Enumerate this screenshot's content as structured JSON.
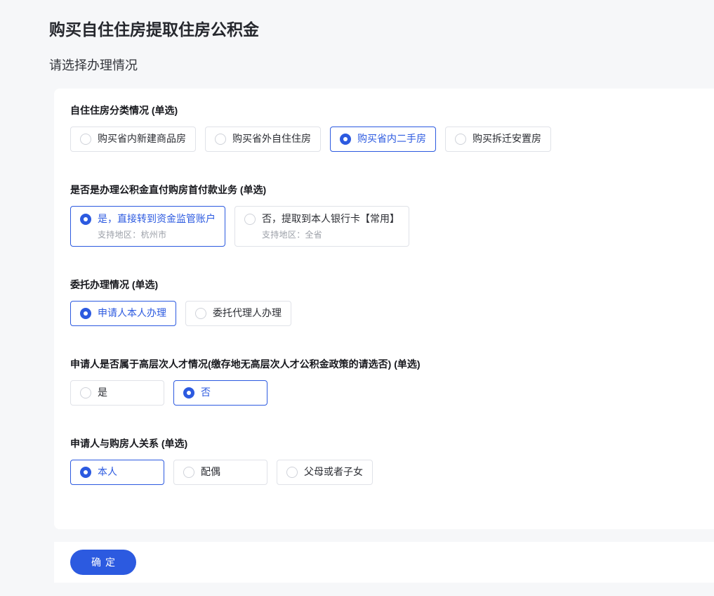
{
  "colors": {
    "accent": "#2c5ae0",
    "page_background": "#f6f7f9",
    "card_background": "#ffffff",
    "unselected_border": "#e0e2e8",
    "sublabel_gray": "#9ca0a8"
  },
  "page": {
    "title": "购买自住住房提取住房公积金",
    "subtitle": "请选择办理情况"
  },
  "form": {
    "sections": [
      {
        "label": "自住住房分类情况 (单选)",
        "options": [
          {
            "label": "购买省内新建商品房",
            "selected": false
          },
          {
            "label": "购买省外自住住房",
            "selected": false
          },
          {
            "label": "购买省内二手房",
            "selected": true
          },
          {
            "label": "购买拆迁安置房",
            "selected": false
          }
        ]
      },
      {
        "label": "是否是办理公积金直付购房首付款业务 (单选)",
        "options": [
          {
            "label": "是，直接转到资金监管账户",
            "sublabel": "支持地区：杭州市",
            "selected": true
          },
          {
            "label": "否，提取到本人银行卡【常用】",
            "sublabel": "支持地区：全省",
            "selected": false
          }
        ]
      },
      {
        "label": "委托办理情况 (单选)",
        "options": [
          {
            "label": "申请人本人办理",
            "selected": true
          },
          {
            "label": "委托代理人办理",
            "selected": false
          }
        ]
      },
      {
        "label": "申请人是否属于高层次人才情况(缴存地无高层次人才公积金政策的请选否) (单选)",
        "options": [
          {
            "label": "是",
            "selected": false
          },
          {
            "label": "否",
            "selected": true
          }
        ]
      },
      {
        "label": "申请人与购房人关系 (单选)",
        "options": [
          {
            "label": "本人",
            "selected": true
          },
          {
            "label": "配偶",
            "selected": false
          },
          {
            "label": "父母或者子女",
            "selected": false
          }
        ]
      }
    ]
  },
  "footer": {
    "confirm_label": "确定"
  }
}
